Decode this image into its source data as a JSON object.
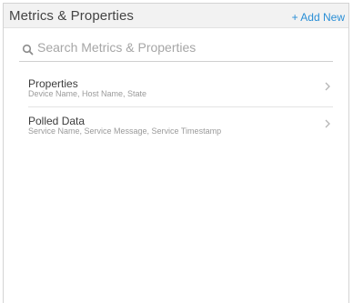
{
  "header": {
    "title": "Metrics & Properties",
    "add_new_label": "+ Add New"
  },
  "search": {
    "placeholder": "Search Metrics & Properties",
    "value": ""
  },
  "items": [
    {
      "title": "Properties",
      "subtitle": "Device Name, Host Name, State",
      "icon": "chevron-right-icon"
    },
    {
      "title": "Polled Data",
      "subtitle": "Service Name, Service Message, Service Timestamp",
      "icon": "chevron-right-icon"
    }
  ],
  "colors": {
    "accent": "#2a8fd6",
    "header_bg": "#f2f2f2",
    "text": "#3c3c3c",
    "muted_text": "#9a9a9a"
  }
}
